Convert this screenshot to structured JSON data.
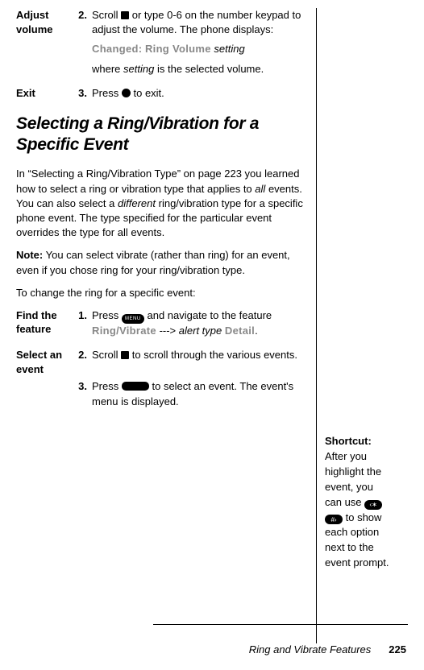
{
  "steps_top": [
    {
      "label": "Adjust volume",
      "num": "2.",
      "body_lead": "Scroll",
      "body_after_icon": "or type 0-6 on the number keypad to adjust the volume. The phone displays:",
      "changed_prefix": "Changed:",
      "changed_mid": "Ring Volume",
      "changed_suffix": "setting",
      "where_line": "where",
      "where_italic": "setting",
      "where_tail": "is the selected volume."
    },
    {
      "label": "Exit",
      "num": "3.",
      "body_lead": "Press",
      "body_tail": "to exit."
    }
  ],
  "heading": "Selecting a Ring/Vibration for a Specific Event",
  "para1_a": "In “Selecting a Ring/Vibration Type” on page 223 you learned how to select a ring or vibration type that applies to",
  "para1_i1": "all",
  "para1_b": "events. You can also select a",
  "para1_i2": "different",
  "para1_c": "ring/vibration type for a specific phone event. The type specified for the particular event overrides the type for all events.",
  "note_label": "Note:",
  "note_body": "You can select vibrate (rather than ring) for an event, even if you chose ring for your ring/vibration type.",
  "para2": "To change the ring for a specific event:",
  "steps_bottom": [
    {
      "label": "Find the feature",
      "num": "1.",
      "b_lead": "Press",
      "b_mid": "and navigate to the feature",
      "b_mono": "Ring/Vibrate",
      "b_arrow": "--->",
      "b_italic": "alert type",
      "b_mono2": "Detail",
      "b_end": "."
    },
    {
      "label": "Select an event",
      "num": "2.",
      "b_lead": "Scroll",
      "b_tail": "to scroll through the various events."
    },
    {
      "label": "",
      "num": "3.",
      "b_lead": "Press",
      "b_tail": "to select an event. The event's menu is displayed."
    }
  ],
  "shortcut": {
    "title": "Shortcut:",
    "body_a": "After you highlight the event, you can use",
    "body_b": "to show each option next to the event prompt."
  },
  "menu_label": "MENU",
  "star1": "‹∗",
  "star2": "#›",
  "footer_title": "Ring and Vibrate Features",
  "footer_page": "225"
}
